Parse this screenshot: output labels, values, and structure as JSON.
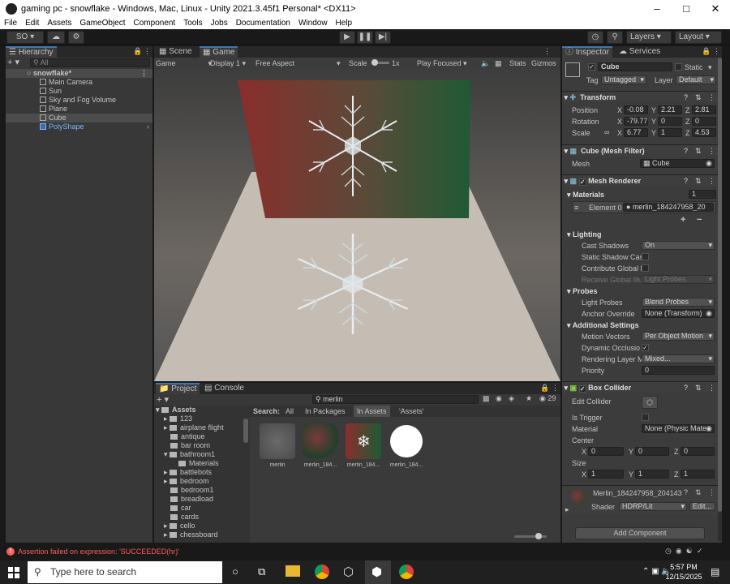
{
  "window": {
    "title": "gaming pc - snowflake - Windows, Mac, Linux - Unity 2021.3.45f1 Personal* <DX11>"
  },
  "menu": [
    "File",
    "Edit",
    "Assets",
    "GameObject",
    "Component",
    "Tools",
    "Jobs",
    "Documentation",
    "Window",
    "Help"
  ],
  "toolbar": {
    "account": "SO",
    "layers": "Layers",
    "layout": "Layout"
  },
  "hierarchy": {
    "tab": "Hierarchy",
    "search_placeholder": "All",
    "scene": "snowflake*",
    "items": [
      "Main Camera",
      "Sun",
      "Sky and Fog Volume",
      "Plane",
      "Cube",
      "PolyShape"
    ]
  },
  "gameview": {
    "tabs": [
      "Scene",
      "Game"
    ],
    "mode": "Game",
    "display": "Display 1",
    "aspect": "Free Aspect",
    "scale_label": "Scale",
    "scale_value": "1x",
    "play_focused": "Play Focused",
    "stats": "Stats",
    "gizmos": "Gizmos"
  },
  "project": {
    "tabs": [
      "Project",
      "Console"
    ],
    "search_value": "merlin",
    "count": "29",
    "search_label": "Search:",
    "filters": [
      "All",
      "In Packages",
      "In Assets",
      "'Assets'"
    ],
    "tree_root": "Assets",
    "tree": [
      "123",
      "airplane flight",
      "antique",
      "bar room",
      "bathroom1",
      "Materials",
      "battlebots",
      "bedroom",
      "bedroom1",
      "breadload",
      "car",
      "cards",
      "cello",
      "chessboard"
    ],
    "assets": [
      "merlin",
      "merlin_184...",
      "merlin_184...",
      "merlin_184..."
    ]
  },
  "inspector": {
    "tabs": [
      "Inspector",
      "Services"
    ],
    "object_name": "Cube",
    "static": "Static",
    "tag_label": "Tag",
    "tag": "Untagged",
    "layer_label": "Layer",
    "layer": "Default",
    "transform": {
      "title": "Transform",
      "position_label": "Position",
      "position": [
        "-0.08",
        "2.21",
        "2.81"
      ],
      "rotation_label": "Rotation",
      "rotation": [
        "-79.77",
        "0",
        "0"
      ],
      "scale_label": "Scale",
      "scale": [
        "6.77",
        "1",
        "4.53"
      ]
    },
    "mesh_filter": {
      "title": "Cube (Mesh Filter)",
      "mesh_label": "Mesh",
      "mesh": "Cube"
    },
    "mesh_renderer": {
      "title": "Mesh Renderer",
      "materials_label": "Materials",
      "materials_count": "1",
      "element0_label": "Element 0",
      "element0": "merlin_184247958_20",
      "lighting": "Lighting",
      "cast_shadows_label": "Cast Shadows",
      "cast_shadows": "On",
      "static_shadow_label": "Static Shadow Cas",
      "contribute_gi_label": "Contribute Global I",
      "receive_gi_label": "Receive Global Illu",
      "receive_gi": "Light Probes",
      "probes": "Probes",
      "light_probes_label": "Light Probes",
      "light_probes": "Blend Probes",
      "anchor_override_label": "Anchor Override",
      "anchor_override": "None (Transform)",
      "additional": "Additional Settings",
      "motion_vectors_label": "Motion Vectors",
      "motion_vectors": "Per Object Motion",
      "dynamic_occlusion_label": "Dynamic Occlusio",
      "rendering_layer_label": "Rendering Layer M",
      "rendering_layer": "Mixed...",
      "priority_label": "Priority",
      "priority": "0"
    },
    "box_collider": {
      "title": "Box Collider",
      "edit_collider": "Edit Collider",
      "is_trigger": "Is Trigger",
      "material_label": "Material",
      "material": "None (Physic Mate",
      "center_label": "Center",
      "center": [
        "0",
        "0",
        "0"
      ],
      "size_label": "Size",
      "size": [
        "1",
        "1",
        "1"
      ]
    },
    "material": {
      "name": "Merlin_184247958_204143",
      "shader_label": "Shader",
      "shader": "HDRP/Lit",
      "edit": "Edit..."
    },
    "add_component": "Add Component"
  },
  "status": {
    "message": "Assertion failed on expression: 'SUCCEEDED(hr)'"
  },
  "taskbar": {
    "search_placeholder": "Type here to search",
    "time": "5:57 PM",
    "date": "12/15/2025"
  },
  "colors": {
    "accent": "#3a79bb",
    "error": "#ff5c5c",
    "selection": "#4c4c4c"
  }
}
